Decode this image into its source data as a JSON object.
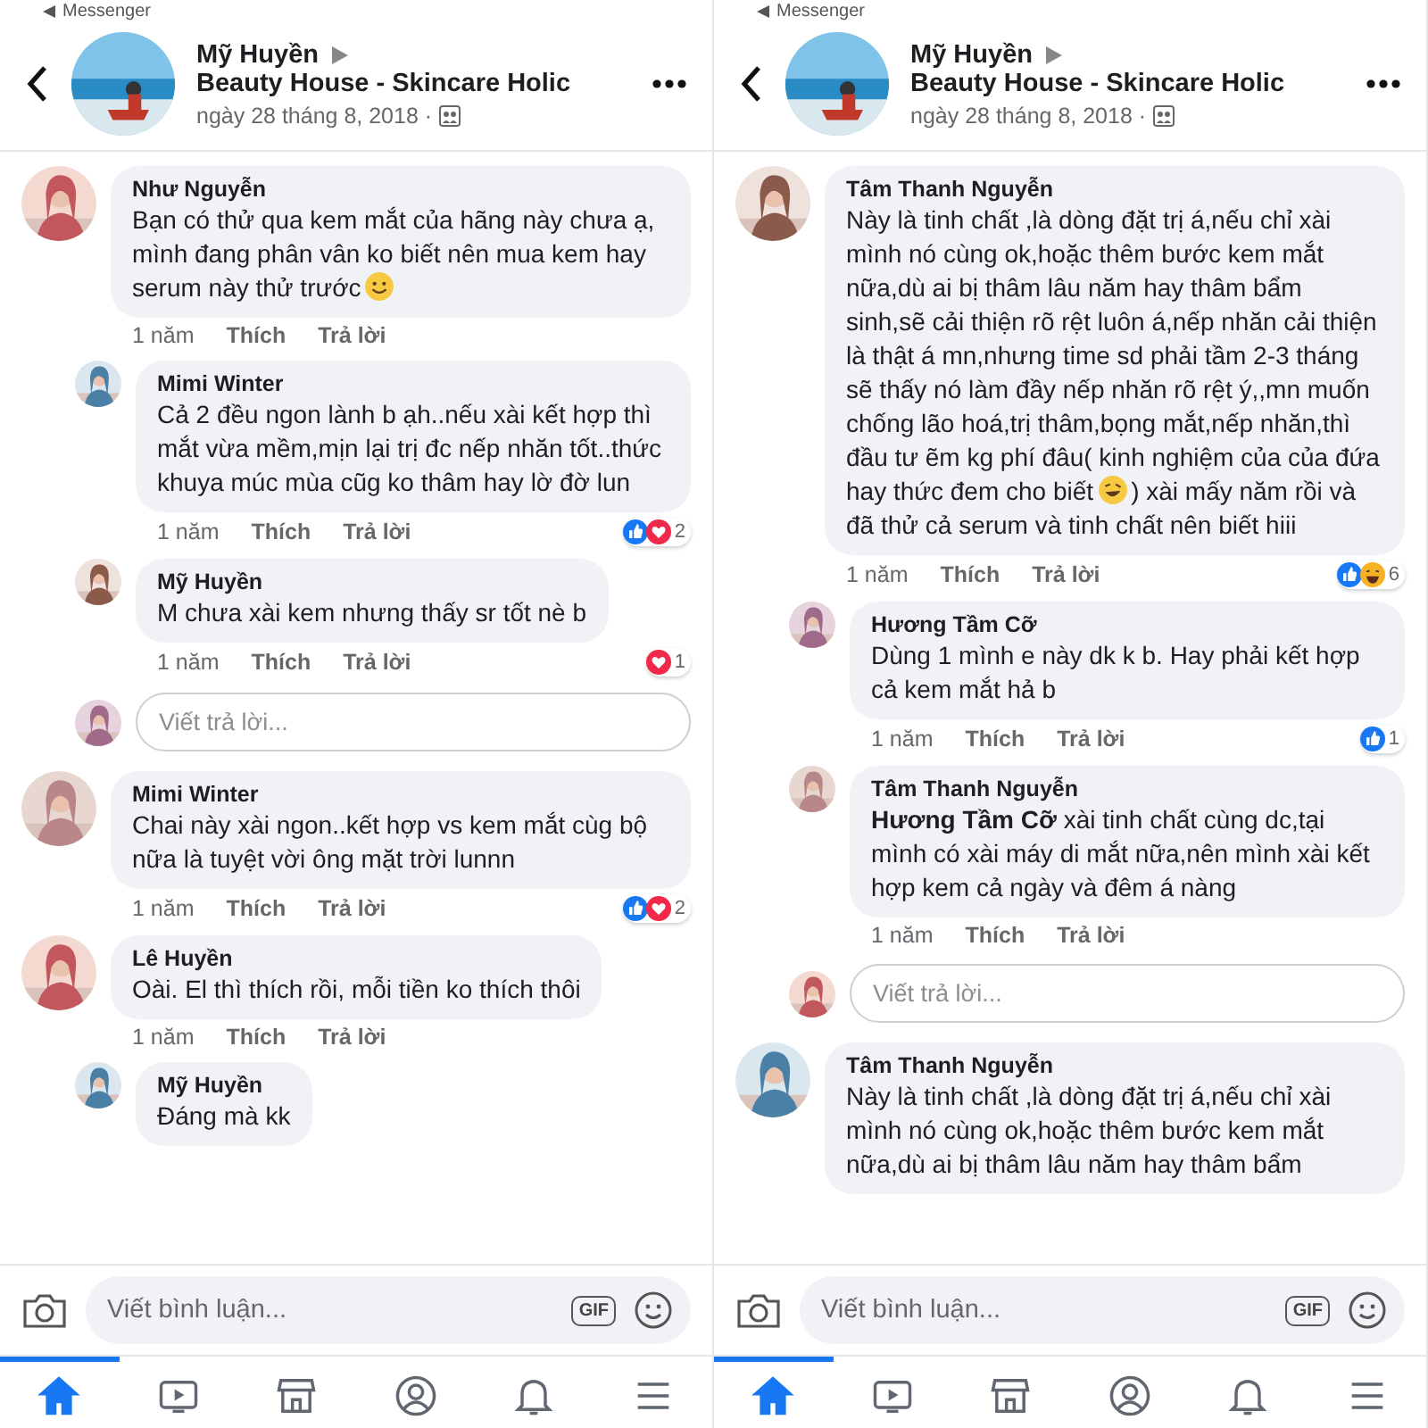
{
  "panels": [
    {
      "status": "Messenger",
      "header": {
        "author": "Mỹ Huyền",
        "target": "Beauty House - Skincare Holic",
        "date": "ngày 28 tháng 8, 2018 ·"
      },
      "comments": [
        {
          "kind": "comment",
          "author": "Như Nguyễn",
          "text": "Bạn có thử qua kem mắt của hãng này chưa ạ, mình đang phân vân ko biết nên mua kem hay serum này thử trước",
          "emoji": {
            "kind": "smile"
          },
          "time": "1 năm",
          "like": "Thích",
          "reply": "Trả lời",
          "replies": [
            {
              "kind": "comment",
              "author": "Mimi Winter",
              "text": "Cả 2 đều ngon lành b ạh..nếu xài kết hợp thì mắt vừa mềm,mịn lại trị đc nếp nhăn tốt..thức khuya múc mùa cũg ko thâm hay lờ đờ lun",
              "time": "1 năm",
              "like": "Thích",
              "reply": "Trả lời",
              "reactions": [
                {
                  "kind": "like"
                },
                {
                  "kind": "love"
                }
              ],
              "reaction_count": "2"
            },
            {
              "kind": "comment",
              "author": "Mỹ Huyền",
              "text": "M chưa xài kem nhưng thấy sr tốt nè b",
              "time": "1 năm",
              "like": "Thích",
              "reply": "Trả lời",
              "reactions": [
                {
                  "kind": "love"
                }
              ],
              "reaction_count": "1"
            },
            {
              "kind": "reply-box",
              "placeholder": "Viết trả lời..."
            }
          ]
        },
        {
          "kind": "comment",
          "author": "Mimi Winter",
          "text": "Chai này xài ngon..kết hợp vs kem mắt cùg bộ nữa là tuyệt vời ông mặt trời lunnn",
          "time": "1 năm",
          "like": "Thích",
          "reply": "Trả lời",
          "reactions": [
            {
              "kind": "like"
            },
            {
              "kind": "love"
            }
          ],
          "reaction_count": "2"
        },
        {
          "kind": "comment",
          "author": "Lê Huyền",
          "text": "Oài. El thì thích rồi, mỗi tiền ko thích thôi",
          "time": "1 năm",
          "like": "Thích",
          "reply": "Trả lời",
          "replies": [
            {
              "kind": "comment",
              "author": "Mỹ Huyền",
              "text": "Đáng mà kk"
            }
          ]
        }
      ],
      "composer": {
        "placeholder": "Viết bình luận...",
        "gif": "GIF"
      },
      "nav": [
        {
          "selected": true
        },
        {
          "selected": false
        },
        {
          "selected": false
        },
        {
          "selected": false
        },
        {
          "selected": false
        },
        {
          "selected": false
        }
      ]
    },
    {
      "status": "Messenger",
      "header": {
        "author": "Mỹ Huyền",
        "target": "Beauty House - Skincare Holic",
        "date": "ngày 28 tháng 8, 2018 ·"
      },
      "comments": [
        {
          "kind": "comment",
          "author": "Tâm Thanh Nguyễn",
          "text": "Này là tinh chất ,là dòng đặt trị á,nếu chỉ xài mình nó cùng ok,hoặc thêm bước kem mắt nữa,dù ai bị thâm lâu năm hay thâm bẩm sinh,sẽ cải thiện rõ rệt luôn á,nếp nhăn cải thiện là thật á mn,nhưng time sd phải tầm 2-3 tháng sẽ thấy nó làm đầy nếp nhăn rõ rệt ý,,mn muốn chống lão hoá,trị thâm,bọng mắt,nếp nhăn,thì đầu tư ẽm kg phí đâu( kinh nghiệm của của đứa hay thức đem cho biết",
          "emoji": {
            "kind": "laugh"
          },
          "text_after": ") xài mấy năm rồi và đã thử cả serum và tinh chất nên biết hiii",
          "time": "1 năm",
          "like": "Thích",
          "reply": "Trả lời",
          "reactions": [
            {
              "kind": "like"
            },
            {
              "kind": "haha"
            }
          ],
          "reaction_count": "6",
          "replies": [
            {
              "kind": "comment",
              "author": "Hương Tầm Cỡ",
              "text": "Dùng 1 mình e này dk k b. Hay phải kết hợp cả kem mắt hả b",
              "time": "1 năm",
              "like": "Thích",
              "reply": "Trả lời",
              "reactions": [
                {
                  "kind": "like"
                }
              ],
              "reaction_count": "1"
            },
            {
              "kind": "comment",
              "author": "Tâm Thanh Nguyễn",
              "text": "**Hương Tầm Cỡ** xài tinh chất cùng dc,tại mình có xài máy di mắt nữa,nên mình xài kết hợp kem cả ngày và đêm á nàng",
              "time": "1 năm",
              "like": "Thích",
              "reply": "Trả lời"
            },
            {
              "kind": "reply-box",
              "placeholder": "Viết trả lời..."
            }
          ]
        },
        {
          "kind": "comment",
          "author": "Tâm Thanh Nguyễn",
          "text": "Này là tinh chất ,là dòng đặt trị á,nếu chỉ xài mình nó cùng ok,hoặc thêm bước kem mắt nữa,dù ai bị thâm lâu năm hay thâm bẩm"
        }
      ],
      "composer": {
        "placeholder": "Viết bình luận...",
        "gif": "GIF"
      },
      "nav": [
        {
          "selected": true
        },
        {
          "selected": false
        },
        {
          "selected": false
        },
        {
          "selected": false
        },
        {
          "selected": false
        },
        {
          "selected": false
        }
      ]
    }
  ]
}
